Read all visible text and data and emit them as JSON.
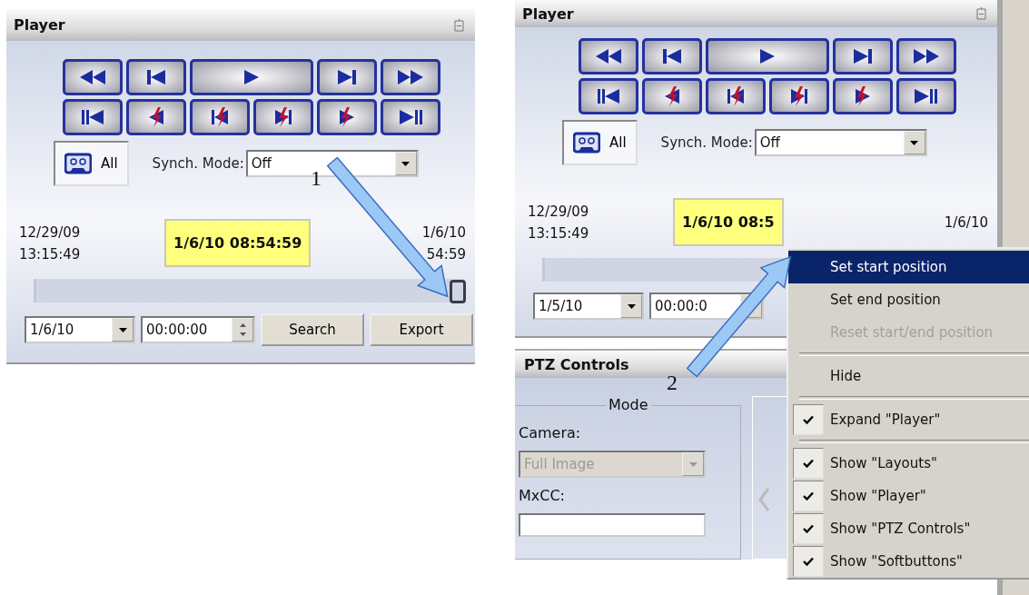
{
  "panels": [
    {
      "title": "Player",
      "source_label": "All",
      "synch_mode_label": "Synch. Mode:",
      "synch_mode_value": "Off",
      "start_time": [
        "12/29/09",
        "13:15:49"
      ],
      "end_time": [
        "1/6/10",
        "54:59"
      ],
      "current_time": "1/6/10 08:54:59",
      "level": 1,
      "date": "1/6/10",
      "time": "00:00:00",
      "buttons": [
        "Search",
        "Export"
      ]
    },
    {
      "title": "Player",
      "source_label": "All",
      "synch_mode_label": "Synch. Mode:",
      "synch_mode_value": "Off",
      "start_time": [
        "12/29/09",
        "13:15:49"
      ],
      "end_time": [
        "1/6/10"
      ],
      "current_time": "1/6/10 08:5",
      "date": "1/5/10",
      "time": "00:00:0"
    }
  ],
  "ptz": {
    "title": "PTZ Controls",
    "group": "Mode",
    "camera_label": "Camera:",
    "camera_value": "Full Image",
    "camera_disabled": true,
    "mxcc_label": "MxCC:"
  },
  "context_menu": [
    {
      "kind": "item",
      "label": "Set start position",
      "selected": true,
      "disabled": false,
      "checked": false
    },
    {
      "kind": "item",
      "label": "Set end position",
      "selected": false,
      "disabled": false,
      "checked": false
    },
    {
      "kind": "item",
      "label": "Reset start/end position",
      "selected": false,
      "disabled": true,
      "checked": false
    },
    {
      "kind": "separator"
    },
    {
      "kind": "item",
      "label": "Hide",
      "selected": false,
      "disabled": false,
      "checked": false
    },
    {
      "kind": "separator"
    },
    {
      "kind": "item",
      "label": "Expand \"Player\"",
      "selected": false,
      "disabled": false,
      "checked": true
    },
    {
      "kind": "separator"
    },
    {
      "kind": "item",
      "label": "Show \"Layouts\"",
      "selected": false,
      "disabled": false,
      "checked": true
    },
    {
      "kind": "item",
      "label": "Show \"Player\"",
      "selected": false,
      "disabled": false,
      "checked": true
    },
    {
      "kind": "item",
      "label": "Show \"PTZ Controls\"",
      "selected": false,
      "disabled": false,
      "checked": true
    },
    {
      "kind": "item",
      "label": "Show \"Softbuttons\"",
      "selected": false,
      "disabled": false,
      "checked": true
    }
  ],
  "callouts": [
    {
      "label": "1"
    },
    {
      "label": "2"
    }
  ]
}
